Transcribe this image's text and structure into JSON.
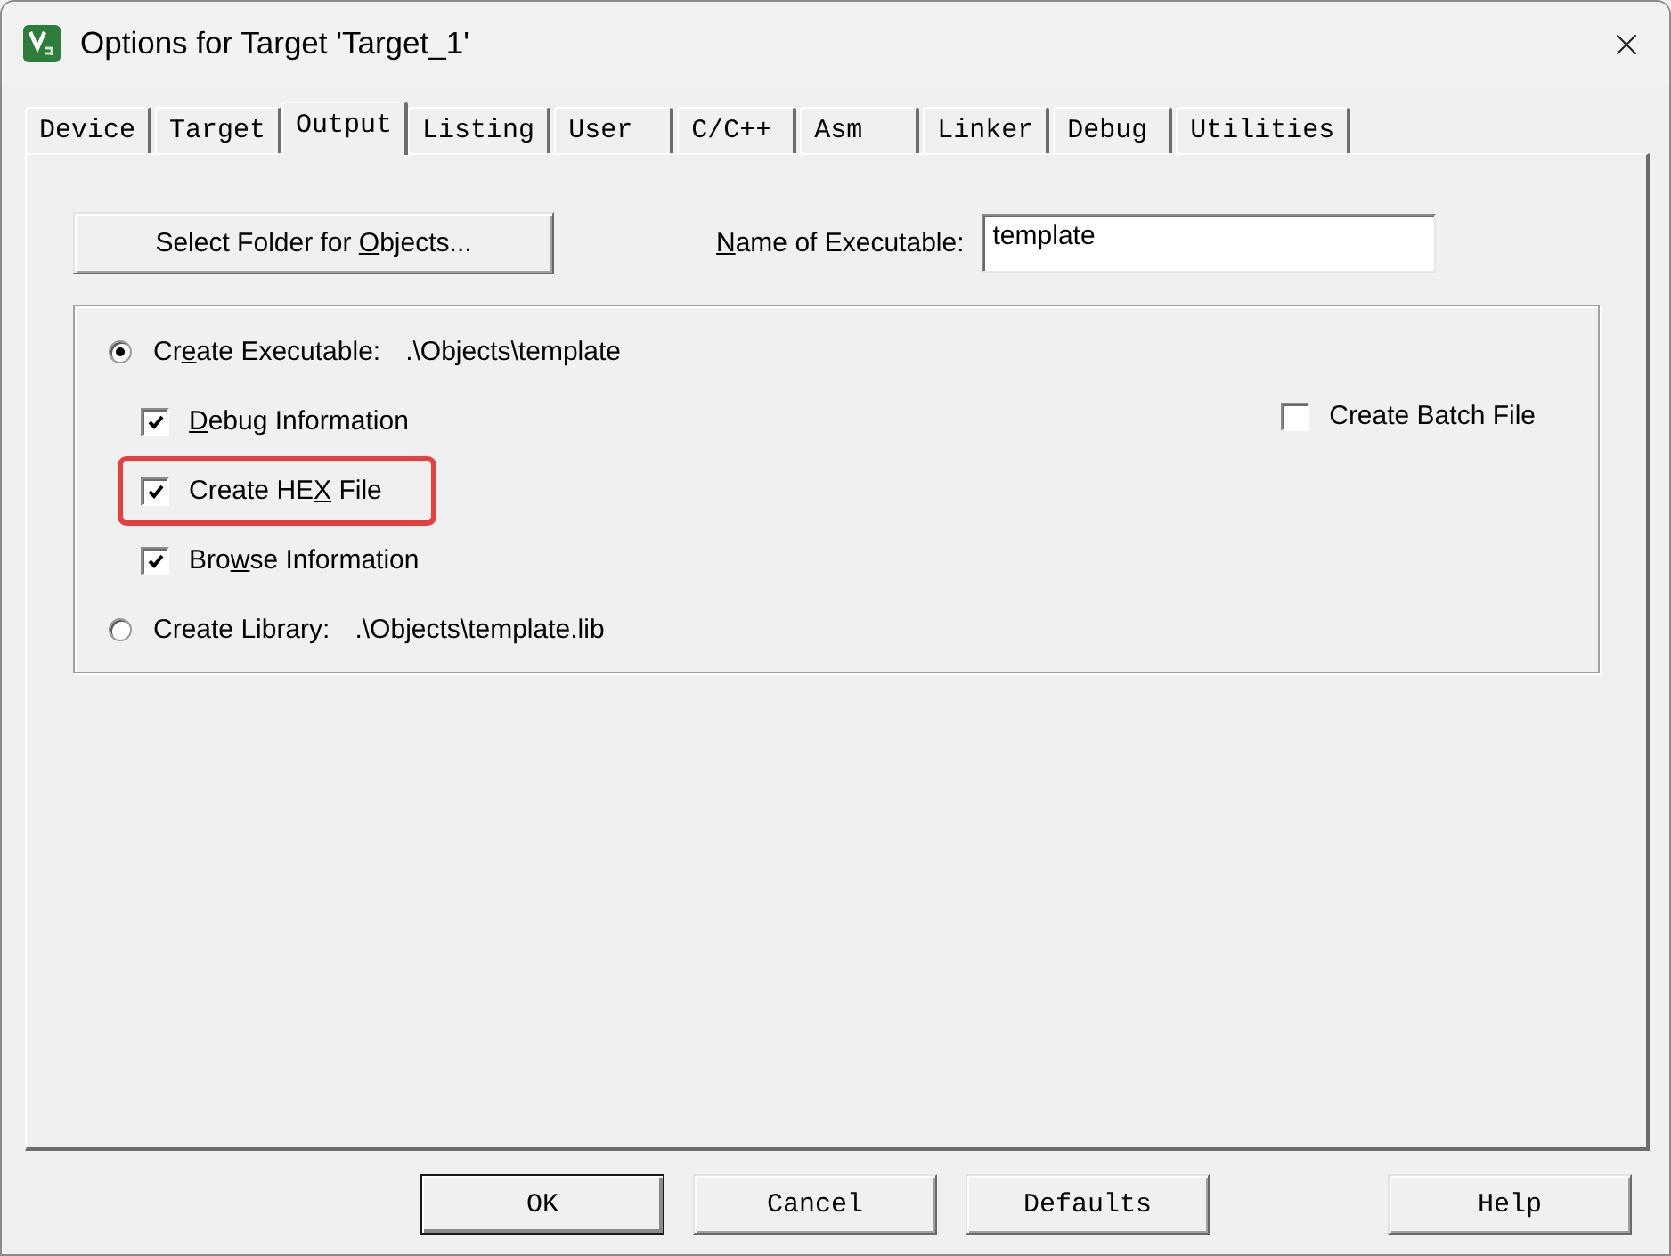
{
  "window": {
    "title": "Options for Target 'Target_1'"
  },
  "tabs": [
    {
      "label": "Device",
      "selected": false
    },
    {
      "label": "Target",
      "selected": false
    },
    {
      "label": "Output",
      "selected": true
    },
    {
      "label": "Listing",
      "selected": false
    },
    {
      "label": "User",
      "selected": false
    },
    {
      "label": "C/C++",
      "selected": false
    },
    {
      "label": "Asm",
      "selected": false
    },
    {
      "label": "Linker",
      "selected": false
    },
    {
      "label": "Debug",
      "selected": false
    },
    {
      "label": "Utilities",
      "selected": false
    }
  ],
  "folder_button": {
    "label_start": "Select Folder for ",
    "access_key": "O",
    "label_end": "bjects..."
  },
  "executable_name": {
    "label": {
      "access_key": "N",
      "label_end": "ame of Executable:"
    },
    "value": "template"
  },
  "output_options": [
    {
      "kind": "radio",
      "label_start": "Cr",
      "access_key": "e",
      "label_end": "ate Executable:",
      "path": ".\\Objects\\template",
      "selected": true
    },
    {
      "kind": "checkbox",
      "access_key": "D",
      "label_end": "ebug Information",
      "checked": true,
      "highlighted": false
    },
    {
      "kind": "checkbox",
      "label_start": "Create HE",
      "access_key": "X",
      "label_end": " File",
      "checked": true,
      "highlighted": true
    },
    {
      "kind": "checkbox",
      "label_start": "Bro",
      "access_key": "w",
      "label_end": "se Information",
      "checked": true,
      "highlighted": false
    },
    {
      "kind": "radio",
      "label_start": "Create Library:",
      "path": ".\\Objects\\template.lib",
      "selected": false
    }
  ],
  "batch_file": {
    "label": "Create Batch File",
    "checked": false
  },
  "buttons": [
    {
      "label": "OK",
      "default": true
    },
    {
      "label": "Cancel",
      "default": false
    },
    {
      "label": "Defaults",
      "default": false
    },
    {
      "label": "Help",
      "default": false
    }
  ]
}
